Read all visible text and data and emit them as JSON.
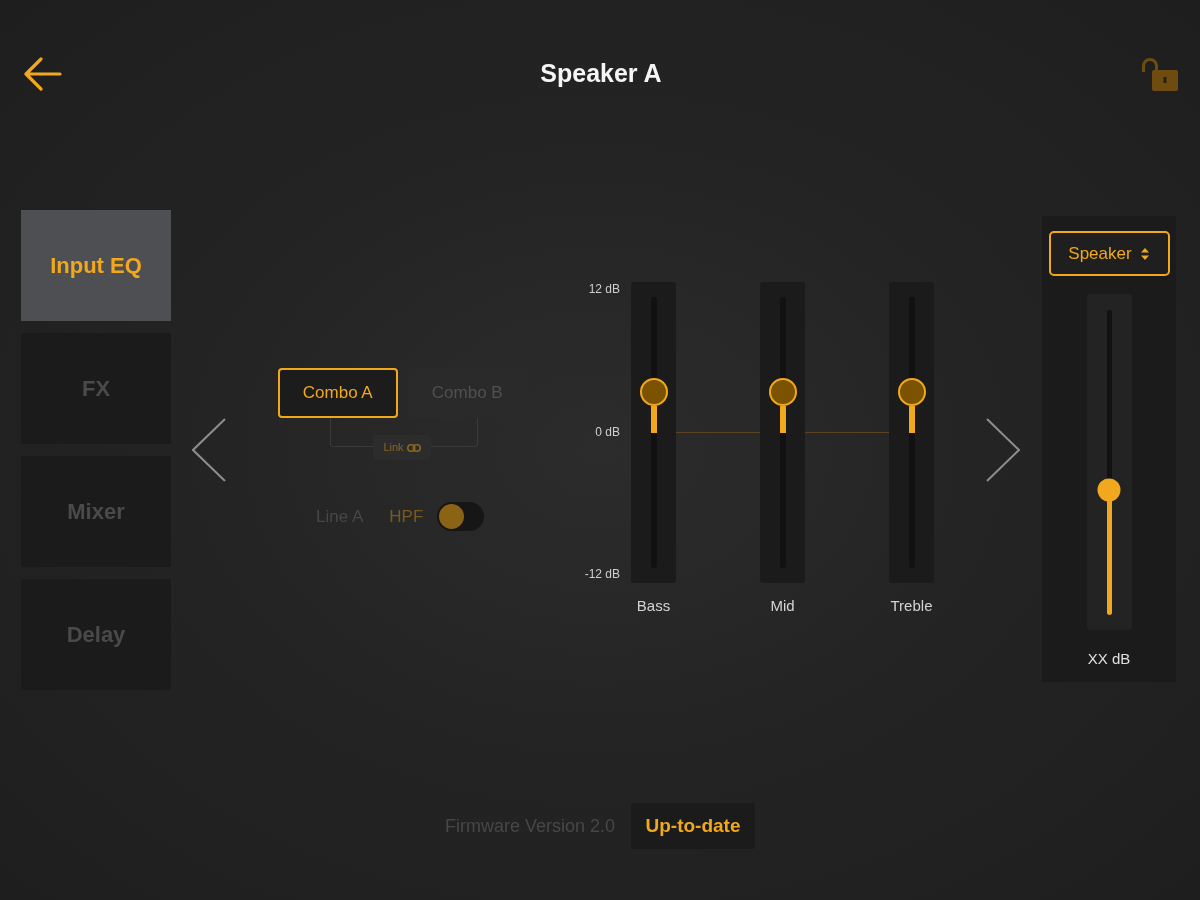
{
  "header": {
    "title": "Speaker A"
  },
  "tabs": [
    {
      "label": "Input EQ",
      "selected": true
    },
    {
      "label": "FX",
      "selected": false
    },
    {
      "label": "Mixer",
      "selected": false
    },
    {
      "label": "Delay",
      "selected": false
    }
  ],
  "combos": [
    {
      "label": "Combo A",
      "selected": true
    },
    {
      "label": "Combo B",
      "selected": false
    }
  ],
  "link": {
    "label": "Link"
  },
  "input": {
    "label": "Line A"
  },
  "hpf": {
    "label": "HPF",
    "on": false
  },
  "eq": {
    "scale": [
      "12 dB",
      "0 dB",
      "-12 dB"
    ],
    "bands": [
      {
        "label": "Bass",
        "level": 0.65
      },
      {
        "label": "Mid",
        "level": 0.65
      },
      {
        "label": "Treble",
        "level": 0.65
      }
    ]
  },
  "output": {
    "selector": "Speaker",
    "level": 0.41,
    "reading": "XX dB"
  },
  "footer": {
    "firmware": "Firmware Version 2.0",
    "status": "Up-to-date"
  }
}
